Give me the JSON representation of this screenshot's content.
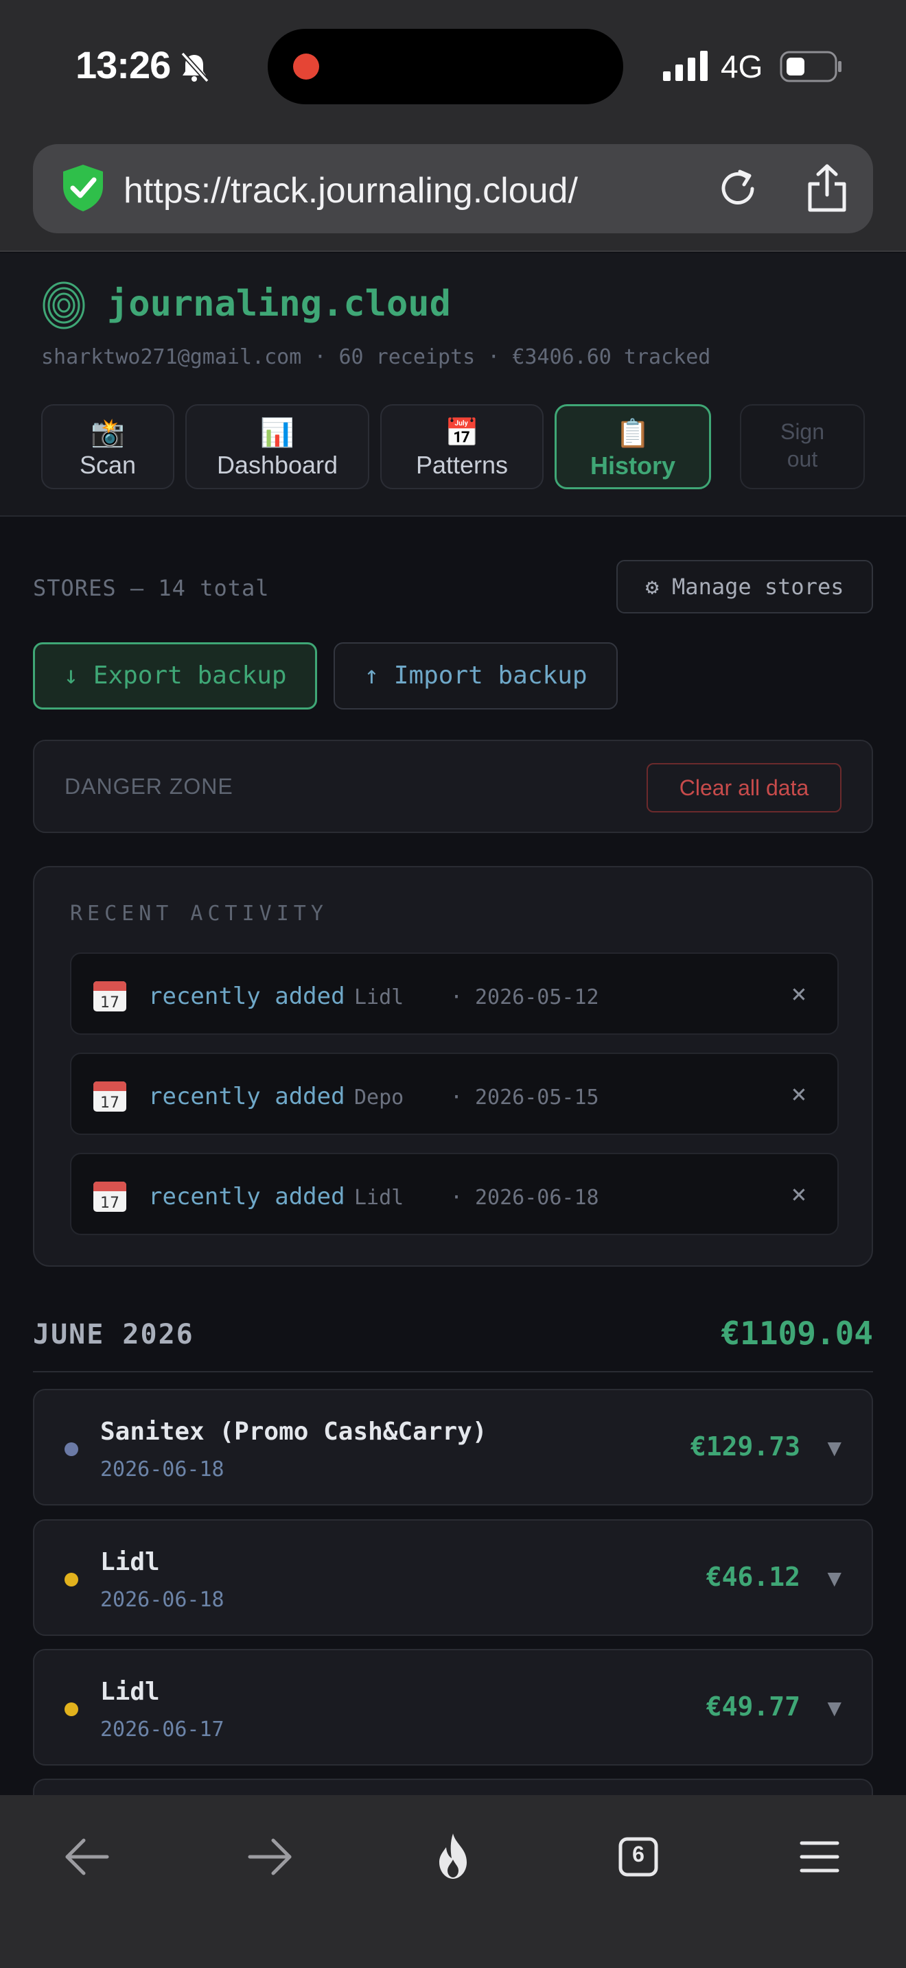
{
  "status_bar": {
    "time": "13:26",
    "network": "4G",
    "icons": [
      "bell-slash-icon",
      "recording-icon",
      "signal-icon",
      "battery-icon"
    ]
  },
  "browser": {
    "url": "https://track.journaling.cloud/",
    "icons": [
      "shield-check-icon",
      "reload-icon",
      "share-icon"
    ]
  },
  "app": {
    "brand": "journaling.cloud",
    "account": {
      "email": "sharktwo271@gmail.com",
      "separator": "·",
      "receipts": "60 receipts",
      "tracked": "€3406.60 tracked"
    },
    "tabs": [
      {
        "label": "Scan",
        "icon": "camera-flash-icon",
        "glyph": "📸"
      },
      {
        "label": "Dashboard",
        "icon": "bar-chart-icon",
        "glyph": "📊"
      },
      {
        "label": "Patterns",
        "icon": "calendar-icon",
        "glyph": "📅"
      },
      {
        "label": "History",
        "icon": "clipboard-icon",
        "glyph": "📋",
        "active": true
      }
    ],
    "sign_out": {
      "line1": "Sign",
      "line2": "out"
    }
  },
  "stores": {
    "label": "STORES — 14 total",
    "manage_button": "⚙ Manage stores"
  },
  "backup": {
    "export_label": "↓ Export backup",
    "import_label": "↑ Import backup"
  },
  "danger": {
    "label": "DANGER ZONE",
    "clear_button": "Clear all data"
  },
  "activity": {
    "title": "RECENT ACTIVITY",
    "items": [
      {
        "tag": "recently added",
        "store": "Lidl",
        "sep": "·",
        "date": "2026-05-12",
        "dismiss": "×"
      },
      {
        "tag": "recently added",
        "store": "Depo",
        "sep": "·",
        "date": "2026-05-15",
        "dismiss": "×"
      },
      {
        "tag": "recently added",
        "store": "Lidl",
        "sep": "·",
        "date": "2026-06-18",
        "dismiss": "×"
      }
    ]
  },
  "month": {
    "label": "JUNE 2026",
    "total": "€1109.04"
  },
  "receipts": [
    {
      "store": "Sanitex (Promo Cash&Carry)",
      "date": "2026-06-18",
      "amount": "€129.73",
      "dot_color": "#6b7aa6",
      "chevron": "▼"
    },
    {
      "store": "Lidl",
      "date": "2026-06-18",
      "amount": "€46.12",
      "dot_color": "#e2b21d",
      "chevron": "▼"
    },
    {
      "store": "Lidl",
      "date": "2026-06-17",
      "amount": "€49.77",
      "dot_color": "#e2b21d",
      "chevron": "▼"
    }
  ],
  "bottom_bar": {
    "tab_count": "6",
    "icons": [
      "back-arrow-icon",
      "forward-arrow-icon",
      "flame-icon",
      "tabs-icon",
      "menu-icon"
    ]
  },
  "colors": {
    "accent_green": "#3fa776",
    "link_blue": "#6fa8c8",
    "danger_red": "#c84b4b",
    "background": "#101116"
  }
}
